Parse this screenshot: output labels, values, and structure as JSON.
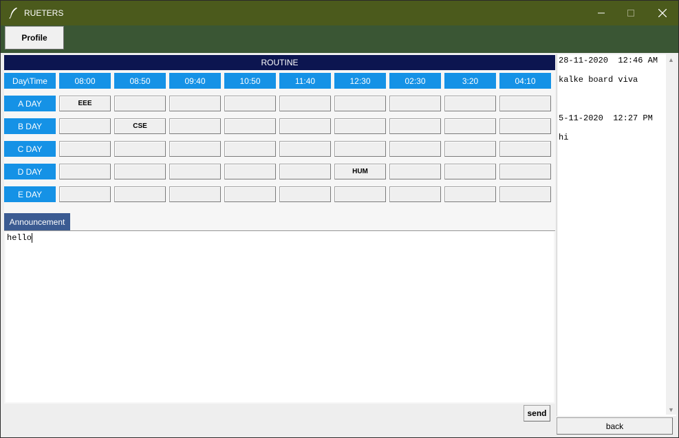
{
  "window": {
    "title": "RUETERS",
    "controls": {
      "minimize_icon": "minimize-icon",
      "maximize_icon": "maximize-icon",
      "close_icon": "close-icon"
    }
  },
  "toolbar": {
    "profile_label": "Profile"
  },
  "routine": {
    "title": "ROUTINE",
    "corner_label": "Day\\Time",
    "times": [
      "08:00",
      "08:50",
      "09:40",
      "10:50",
      "11:40",
      "12:30",
      "02:30",
      "3:20",
      "04:10"
    ],
    "rows": [
      {
        "day": "A DAY",
        "cells": [
          "EEE",
          "",
          "",
          "",
          "",
          "",
          "",
          "",
          ""
        ]
      },
      {
        "day": "B DAY",
        "cells": [
          "",
          "CSE",
          "",
          "",
          "",
          "",
          "",
          "",
          ""
        ]
      },
      {
        "day": "C DAY",
        "cells": [
          "",
          "",
          "",
          "",
          "",
          "",
          "",
          "",
          ""
        ]
      },
      {
        "day": "D DAY",
        "cells": [
          "",
          "",
          "",
          "",
          "",
          "HUM",
          "",
          "",
          ""
        ]
      },
      {
        "day": "E DAY",
        "cells": [
          "",
          "",
          "",
          "",
          "",
          "",
          "",
          "",
          ""
        ]
      }
    ]
  },
  "announcement": {
    "tab_label": "Announcement",
    "text": "hello",
    "send_label": "send"
  },
  "feed": {
    "items": [
      {
        "datetime": "28-11-2020  12:46 AM",
        "message": "kalke board viva"
      },
      {
        "datetime": "5-11-2020  12:27 PM",
        "message": "hi"
      }
    ],
    "back_label": "back"
  },
  "colors": {
    "titlebar": "#4b5a1c",
    "toolbar": "#3a5634",
    "routine_header": "#0c1550",
    "time_cell": "#1592e6",
    "announcement_tab": "#3b5b92"
  }
}
